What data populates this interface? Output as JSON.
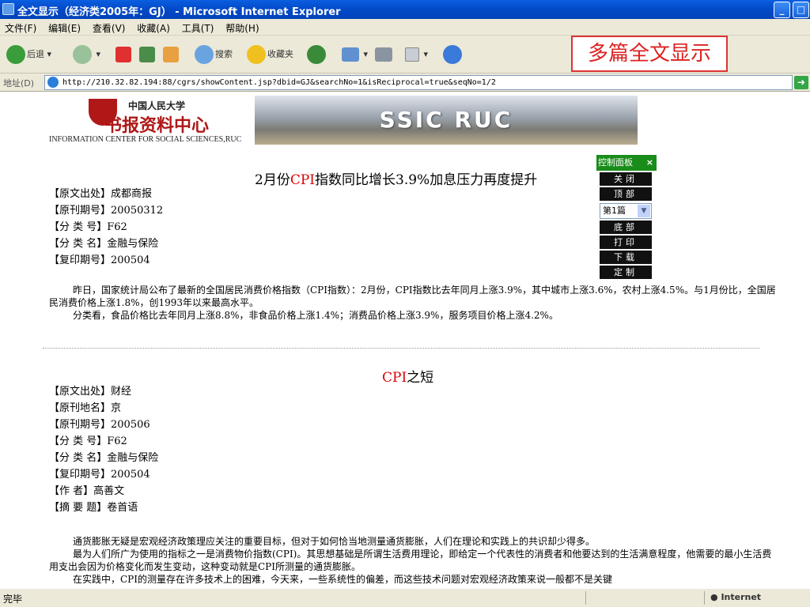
{
  "window": {
    "title": "全文显示（经济类2005年：GJ） - Microsoft Internet Explorer",
    "controls": [
      "_",
      "□"
    ]
  },
  "menu": [
    "文件(F)",
    "编辑(E)",
    "查看(V)",
    "收藏(A)",
    "工具(T)",
    "帮助(H)"
  ],
  "toolbar": {
    "back": "后退",
    "search": "搜索",
    "favorites": "收藏夹"
  },
  "annotation": "多篇全文显示",
  "address": {
    "label": "地址(D)",
    "url": "http://210.32.82.194:88/cgrs/showContent.jsp?dbid=GJ&searchNo=1&isReciprocal=true&seqNo=1/2"
  },
  "logo": {
    "cn_name": "中国人民大学",
    "calligraphy": "书报资料中心",
    "en_name": "INFORMATION CENTER FOR SOCIAL SCIENCES,RUC",
    "banner": "SSIC RUC"
  },
  "panel": {
    "title": "控制面板",
    "close_x": "×",
    "buttons": [
      "关闭",
      "顶部"
    ],
    "select_value": "第1篇",
    "buttons2": [
      "底部",
      "打印",
      "下载",
      "定制"
    ]
  },
  "article1": {
    "title_prefix": "2月份",
    "title_highlight": "CPI",
    "title_suffix": "指数同比增长3.9%加息压力再度提升",
    "meta": [
      "【原文出处】成都商报",
      "【原刊期号】20050312",
      "【分 类 号】F62",
      "【分 类 名】金融与保险",
      "【复印期号】200504"
    ],
    "paragraphs": [
      "昨日，国家统计局公布了最新的全国居民消费价格指数（CPI指数）：2月份，CPI指数比去年同月上涨3.9%，其中城市上涨3.6%，农村上涨4.5%。与1月份比，全国居民消费价格上涨1.8%，创1993年以来最高水平。",
      "分类看，食品价格比去年同月上涨8.8%，非食品价格上涨1.4%；消费品价格上涨3.9%，服务项目价格上涨4.2%。"
    ]
  },
  "article2": {
    "title_highlight": "CPI",
    "title_suffix": "之短",
    "meta": [
      "【原文出处】财经",
      "【原刊地名】京",
      "【原刊期号】200506",
      "【分 类 号】F62",
      "【分 类 名】金融与保险",
      "【复印期号】200504",
      "【作 者】高善文",
      "【摘 要 题】卷首语"
    ],
    "paragraphs": [
      "通货膨胀无疑是宏观经济政策理应关注的重要目标，但对于如何恰当地测量通货膨胀，人们在理论和实践上的共识却少得多。",
      "最为人们所广为使用的指标之一是消费物价指数(CPI)。其思想基础是所谓生活费用理论，即给定一个代表性的消费者和他要达到的生活满意程度，他需要的最小生活费用支出会因为价格变化而发生变动，这种变动就是CPI所测量的通货膨胀。",
      "在实践中，CPI的测量存在许多技术上的困难，今天来，一些系统性的偏差，而这些技术问题对宏观经济政策来说一般都不是关键"
    ]
  },
  "status": {
    "left": "完毕",
    "zone": "Internet"
  }
}
